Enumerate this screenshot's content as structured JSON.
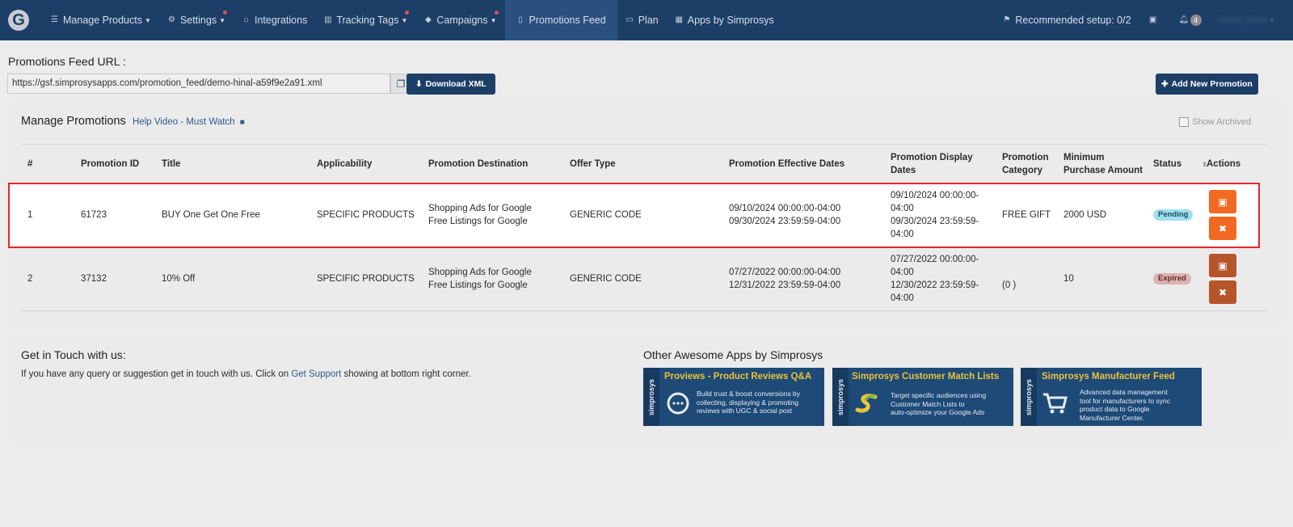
{
  "nav": {
    "logo": "G",
    "items": [
      {
        "label": "Manage Products",
        "icon": "list-icon",
        "caret": true,
        "dot": false
      },
      {
        "label": "Settings",
        "icon": "gear-icon",
        "caret": true,
        "dot": true
      },
      {
        "label": "Integrations",
        "icon": "store-icon",
        "caret": false,
        "dot": false
      },
      {
        "label": "Tracking Tags",
        "icon": "bar-chart-icon",
        "caret": true,
        "dot": true
      },
      {
        "label": "Campaigns",
        "icon": "tag-icon",
        "caret": true,
        "dot": true
      },
      {
        "label": "Promotions Feed",
        "icon": "file-icon",
        "caret": false,
        "dot": false
      },
      {
        "label": "Plan",
        "icon": "card-icon",
        "caret": false,
        "dot": false
      },
      {
        "label": "Apps by Simprosys",
        "icon": "grid-icon",
        "caret": false,
        "dot": false
      }
    ],
    "recommended": "Recommended setup: 0/2",
    "notifications": "4",
    "username": "Demo_Hinal"
  },
  "feed": {
    "label": "Promotions Feed URL :",
    "url": "https://gsf.simprosysapps.com/promotion_feed/demo-hinal-a59f9e2a91.xml",
    "download_label": "Download XML",
    "add_label": "Add New Promotion"
  },
  "manage": {
    "title": "Manage Promotions",
    "help": "Help Video - Must Watch",
    "show_archived": "Show Archived",
    "headers": {
      "num": "#",
      "id": "Promotion ID",
      "title": "Title",
      "applicability": "Applicability",
      "destination": "Promotion Destination",
      "offer": "Offer Type",
      "effective": "Promotion Effective Dates",
      "display_1": "Promotion Display",
      "display_2": "Dates",
      "category_1": "Promotion",
      "category_2": "Category",
      "min_1": "Minimum",
      "min_2": "Purchase Amount",
      "status": "Status",
      "actions": "Actions"
    },
    "rows": [
      {
        "num": "1",
        "id": "61723",
        "title": "BUY One Get One Free",
        "applicability": "SPECIFIC PRODUCTS",
        "dest_1": "Shopping Ads for Google",
        "dest_2": "Free Listings for Google",
        "offer": "GENERIC CODE",
        "eff_1": "09/10/2024 00:00:00-04:00",
        "eff_2": "09/30/2024 23:59:59-04:00",
        "disp_1": "09/10/2024 00:00:00-",
        "disp_2": "04:00",
        "disp_3": "09/30/2024 23:59:59-",
        "disp_4": "04:00",
        "category": "FREE GIFT",
        "min": "2000 USD",
        "status": "Pending",
        "status_color": "#9fe0f0"
      },
      {
        "num": "2",
        "id": "37132",
        "title": "10% Off",
        "applicability": "SPECIFIC PRODUCTS",
        "dest_1": "Shopping Ads for Google",
        "dest_2": "Free Listings for Google",
        "offer": "GENERIC CODE",
        "eff_1": "07/27/2022 00:00:00-04:00",
        "eff_2": "12/31/2022 23:59:59-04:00",
        "disp_1": "07/27/2022 00:00:00-",
        "disp_2": "04:00",
        "disp_3": "12/30/2022 23:59:59-",
        "disp_4": "04:00",
        "category": "(0 )",
        "min": "10",
        "status": "Expired",
        "status_color": "#d9b3b0"
      }
    ]
  },
  "contact": {
    "title": "Get in Touch with us:",
    "text_pre": "If you have any query or suggestion get in touch with us. Click on ",
    "link": "Get Support",
    "text_post": " showing at bottom right corner."
  },
  "other_apps": {
    "title": "Other Awesome Apps by Simprosys",
    "brand": "simprosys",
    "apps": [
      {
        "name": "Proviews - Product Reviews Q&A",
        "desc_1": "Build trust & boost conversions by",
        "desc_2": "collecting, displaying & promoting",
        "desc_3": "reviews with UGC & social post",
        "desc_4": ""
      },
      {
        "name": "Simprosys Customer Match Lists",
        "desc_1": "Target specific audiences using",
        "desc_2": "Customer Match Lists to",
        "desc_3": "auto-optimize your Google Ads",
        "desc_4": ""
      },
      {
        "name": "Simprosys Manufacturer Feed",
        "desc_1": "Advanced data management",
        "desc_2": "tool for manufacturers to sync",
        "desc_3": "product data to Google",
        "desc_4": "Manufacturer Center."
      }
    ]
  },
  "colors": {
    "nav_bg": "#1d3f67",
    "action_orange": "#f26a21",
    "highlight_border": "#e5252a"
  }
}
